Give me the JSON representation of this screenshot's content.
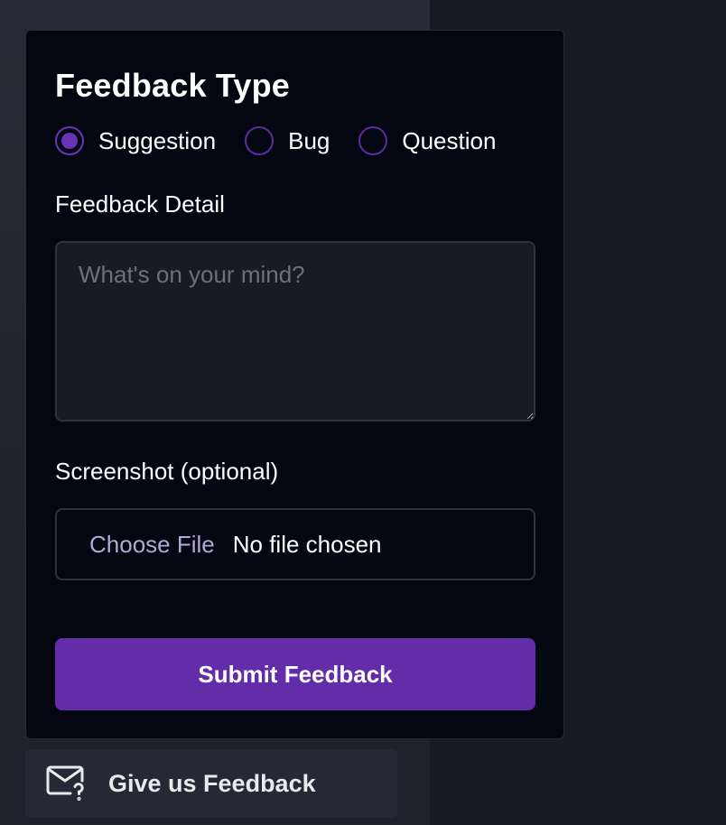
{
  "form": {
    "title": "Feedback Type",
    "feedback_types": [
      {
        "label": "Suggestion",
        "checked": true
      },
      {
        "label": "Bug",
        "checked": false
      },
      {
        "label": "Question",
        "checked": false
      }
    ],
    "detail_label": "Feedback Detail",
    "detail_placeholder": "What's on your mind?",
    "detail_value": "",
    "screenshot_label": "Screenshot (optional)",
    "file_button": "Choose File",
    "file_status": "No file chosen",
    "submit_label": "Submit Feedback"
  },
  "trigger": {
    "label": "Give us Feedback",
    "icon": "mail-question-icon"
  },
  "colors": {
    "accent": "#632ca9",
    "panel_bg": "#040711",
    "page_bg": "#161b24"
  }
}
